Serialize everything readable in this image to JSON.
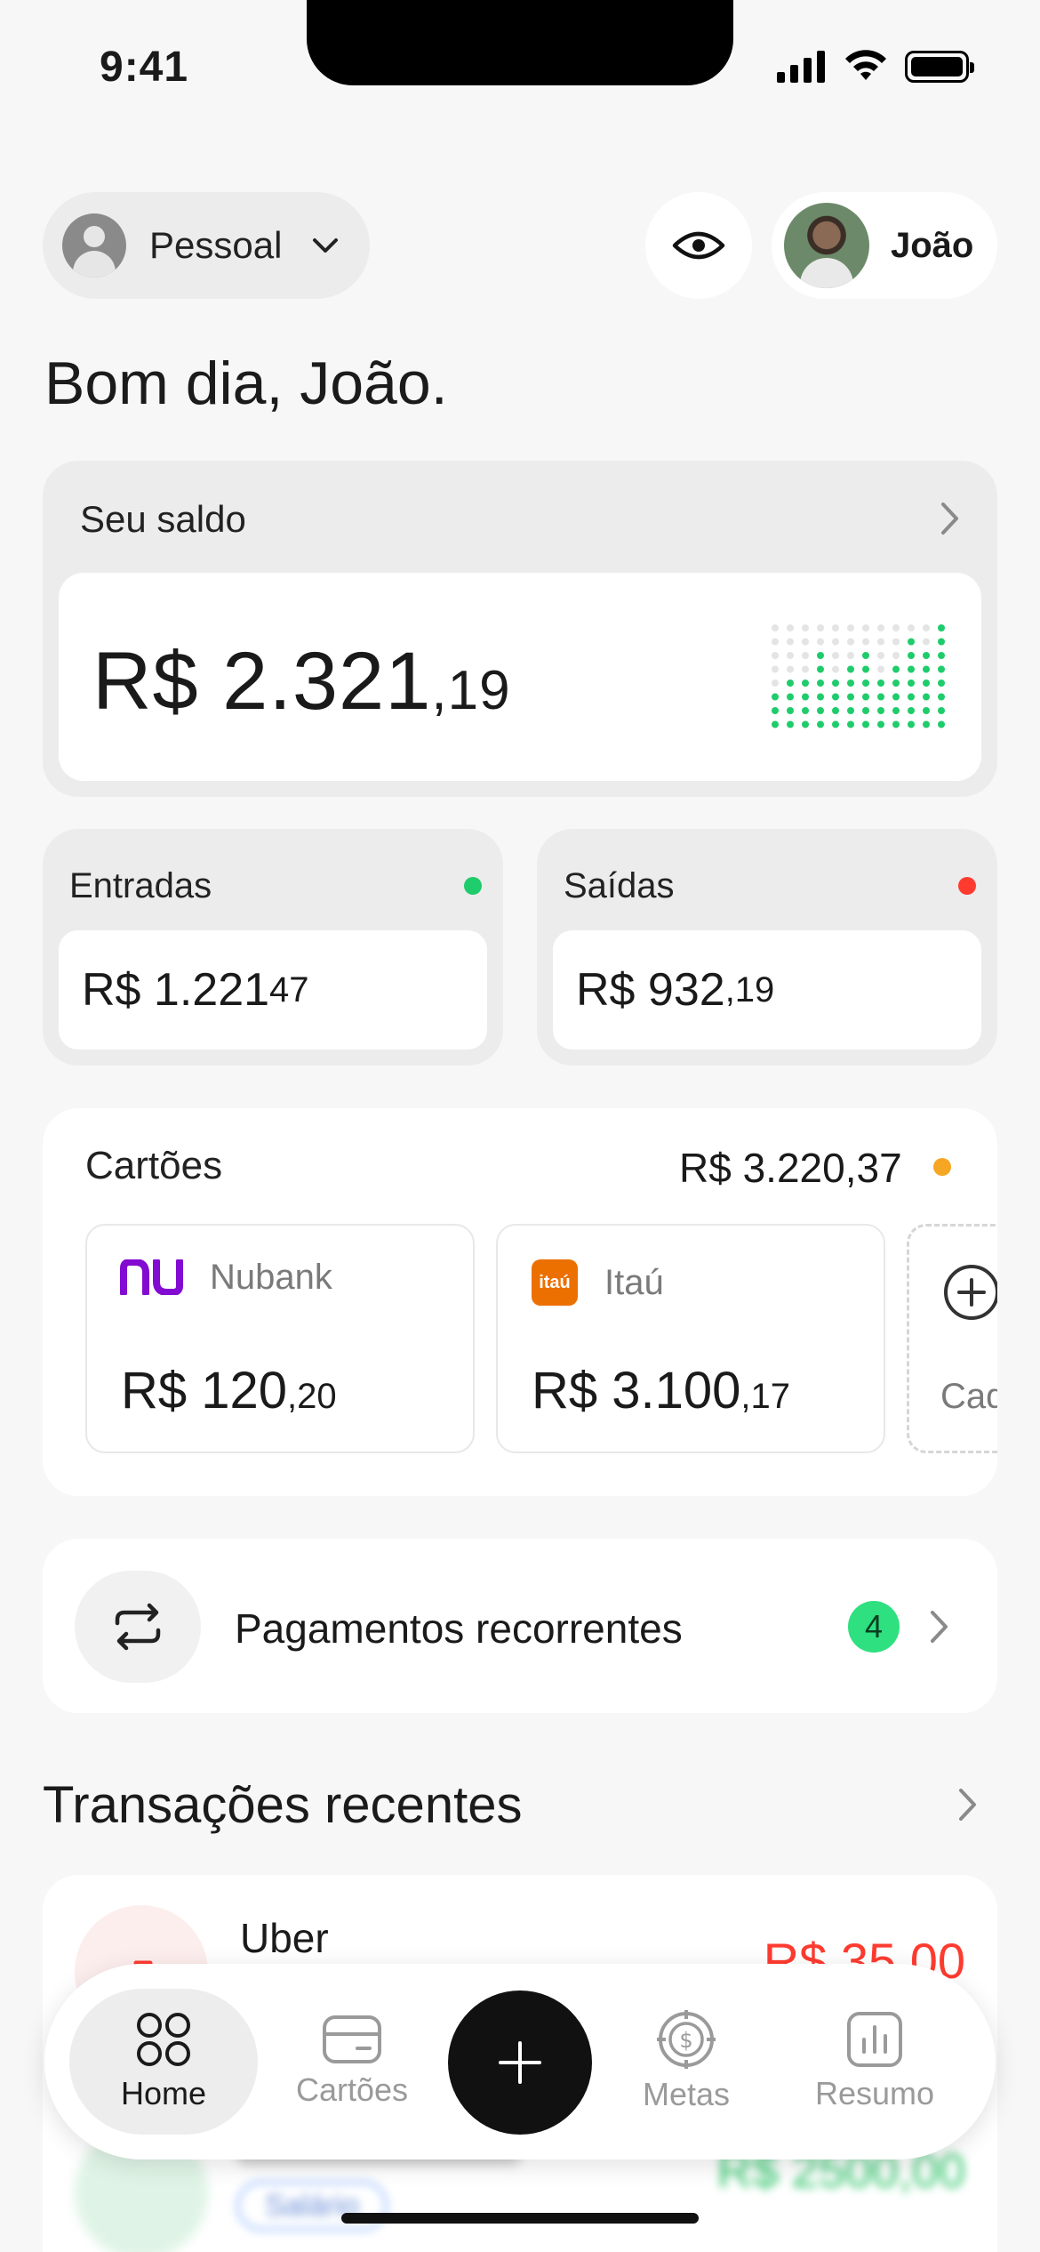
{
  "status_bar": {
    "time": "9:41"
  },
  "header": {
    "profile_selector_label": "Pessoal",
    "user_name": "João"
  },
  "greeting": "Bom dia, João.",
  "balance": {
    "title": "Seu saldo",
    "amount_main": "R$ 2.321",
    "amount_cents": ",19"
  },
  "income": {
    "title": "Entradas",
    "amount_main": "R$ 1.221",
    "amount_cents": "47",
    "dot_color": "#1fcc6b"
  },
  "expenses": {
    "title": "Saídas",
    "amount_main": "R$ 932",
    "amount_cents": ",19",
    "dot_color": "#ff3b30"
  },
  "cards": {
    "title": "Cartões",
    "total_main": "R$ 3.220",
    "total_cents": ",37",
    "items": [
      {
        "bank": "Nubank",
        "logo_text": "nu",
        "amount_main": "R$ 120",
        "amount_cents": ",20"
      },
      {
        "bank": "Itaú",
        "logo_text": "itaú",
        "amount_main": "R$ 3.100",
        "amount_cents": ",17"
      }
    ],
    "add_label": "Cad"
  },
  "recurring": {
    "label": "Pagamentos recorrentes",
    "badge_count": "4"
  },
  "transactions": {
    "title": "Transações recentes",
    "items": [
      {
        "name": "Uber",
        "amount": "R$ 35,00"
      }
    ],
    "blurred": {
      "tag": "Salário",
      "amount": "R$ 2500,00"
    }
  },
  "tabbar": {
    "home": "Home",
    "cards": "Cartões",
    "goals": "Metas",
    "summary": "Resumo"
  },
  "colors": {
    "accent_green": "#2ee07f",
    "accent_orange": "#f5a623",
    "negative_red": "#ff3b30",
    "nubank_purple": "#820ad1",
    "itau_orange": "#ec7000"
  }
}
